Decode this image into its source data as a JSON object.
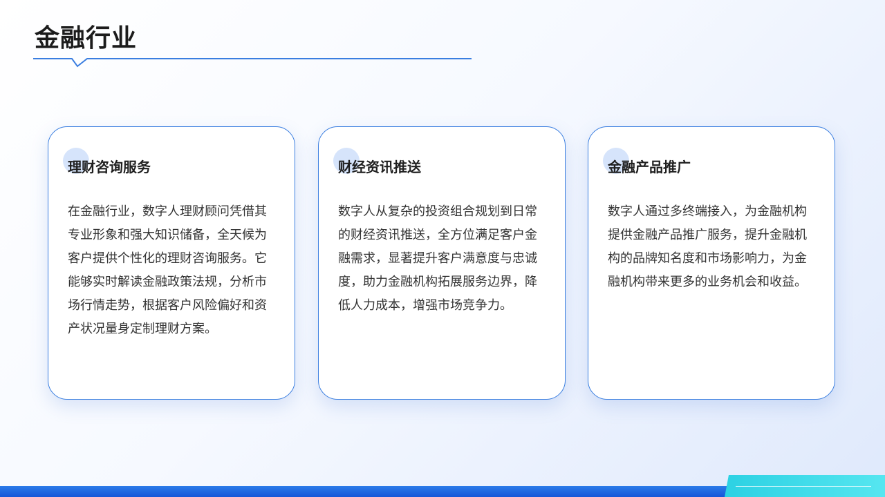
{
  "page": {
    "title": "金融行业"
  },
  "cards": [
    {
      "title": "理财咨询服务",
      "body": "在金融行业，数字人理财顾问凭借其专业形象和强大知识储备，全天候为客户提供个性化的理财咨询服务。它能够实时解读金融政策法规，分析市场行情走势，根据客户风险偏好和资产状况量身定制理财方案。"
    },
    {
      "title": "财经资讯推送",
      "body": "数字人从复杂的投资组合规划到日常的财经资讯推送，全方位满足客户金融需求，显著提升客户满意度与忠诚度，助力金融机构拓展服务边界，降低人力成本，增强市场竞争力。"
    },
    {
      "title": "金融产品推广",
      "body": "数字人通过多终端接入，为金融机构提供金融产品推广服务，提升金融机构的品牌知名度和市场影响力，为金融机构带来更多的业务机会和收益。"
    }
  ],
  "colors": {
    "accent": "#3a7ee0",
    "dot": "#d6e4fb",
    "bottom_bar": "#1a63de",
    "bottom_accent": "#3fdce9"
  }
}
